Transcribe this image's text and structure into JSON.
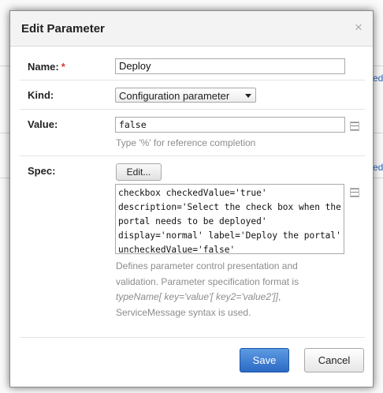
{
  "background": {
    "links": [
      "ed",
      "ed"
    ]
  },
  "dialog": {
    "title": "Edit Parameter",
    "close_symbol": "×",
    "fields": {
      "name": {
        "label": "Name:",
        "required_mark": "*",
        "value": "Deploy"
      },
      "kind": {
        "label": "Kind:",
        "selected": "Configuration parameter"
      },
      "value": {
        "label": "Value:",
        "value": "false",
        "hint": "Type '%' for reference completion"
      },
      "spec": {
        "label": "Spec:",
        "edit_button": "Edit...",
        "value": "checkbox checkedValue='true' description='Select the check box when the portal needs to be deployed' display='normal' label='Deploy the portal' uncheckedValue='false'",
        "description_1": "Defines parameter control presentation and validation. Parameter specification format is",
        "description_2": "typeName[ key='value'[ key2='value2']]",
        "description_3": ", ServiceMessage syntax is used."
      }
    },
    "buttons": {
      "save": "Save",
      "cancel": "Cancel"
    },
    "colors": {
      "primary": "#2c6ac4",
      "required": "#d43c2f",
      "hint": "#8c8c8c"
    },
    "icons": [
      "close-icon",
      "text-field-expand-icon",
      "textarea-expand-icon",
      "dropdown-arrow-icon"
    ]
  }
}
